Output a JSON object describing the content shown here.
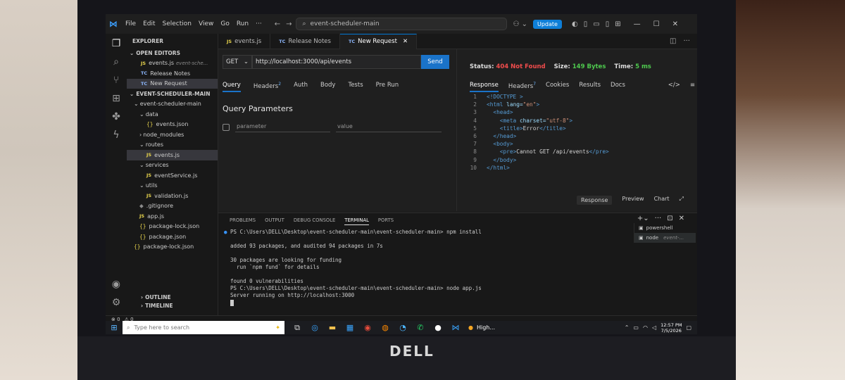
{
  "titlebar": {
    "menu": [
      "File",
      "Edit",
      "Selection",
      "View",
      "Go",
      "Run",
      "···"
    ],
    "search": "event-scheduler-main",
    "update_label": "Update"
  },
  "explorer": {
    "title": "EXPLORER",
    "open_editors_label": "OPEN EDITORS",
    "open_editors": [
      {
        "icon": "JS",
        "name": "events.js",
        "hint": "event-sche..."
      },
      {
        "icon": "TC",
        "name": "Release Notes",
        "hint": ""
      },
      {
        "icon": "TC",
        "name": "New Request",
        "hint": ""
      }
    ],
    "workspace_label": "EVENT-SCHEDULER-MAIN",
    "tree": [
      {
        "indent": 10,
        "type": "folder",
        "name": "event-scheduler-main"
      },
      {
        "indent": 18,
        "type": "folder",
        "name": "data"
      },
      {
        "indent": 28,
        "type": "json",
        "name": "events.json"
      },
      {
        "indent": 18,
        "type": "folder-closed",
        "name": "node_modules"
      },
      {
        "indent": 18,
        "type": "folder",
        "name": "routes"
      },
      {
        "indent": 28,
        "type": "js",
        "name": "events.js"
      },
      {
        "indent": 18,
        "type": "folder",
        "name": "services"
      },
      {
        "indent": 28,
        "type": "js",
        "name": "eventService.js"
      },
      {
        "indent": 18,
        "type": "folder",
        "name": "utils"
      },
      {
        "indent": 28,
        "type": "js",
        "name": "validation.js"
      },
      {
        "indent": 18,
        "type": "git",
        "name": ".gitignore"
      },
      {
        "indent": 18,
        "type": "js",
        "name": "app.js"
      },
      {
        "indent": 18,
        "type": "json",
        "name": "package-lock.json"
      },
      {
        "indent": 18,
        "type": "json",
        "name": "package.json"
      },
      {
        "indent": 10,
        "type": "json",
        "name": "package-lock.json"
      }
    ],
    "outline_label": "OUTLINE",
    "timeline_label": "TIMELINE"
  },
  "tabs": [
    {
      "icon": "JS",
      "label": "events.js"
    },
    {
      "icon": "TC",
      "label": "Release Notes"
    },
    {
      "icon": "TC",
      "label": "New Request",
      "close": "✕"
    }
  ],
  "request": {
    "method": "GET",
    "url": "http://localhost:3000/api/events",
    "send_label": "Send",
    "tabs": [
      "Query",
      "Headers",
      "Auth",
      "Body",
      "Tests",
      "Pre Run"
    ],
    "headers_count": "2",
    "query_title": "Query Parameters",
    "param_placeholder": "parameter",
    "value_placeholder": "value"
  },
  "response": {
    "status_label": "Status:",
    "status_value": "404 Not Found",
    "size_label": "Size:",
    "size_value": "149 Bytes",
    "time_label": "Time:",
    "time_value": "5 ms",
    "tabs": [
      "Response",
      "Headers",
      "Cookies",
      "Results",
      "Docs"
    ],
    "headers_count": "7",
    "bottom_tabs": [
      "Response",
      "Preview",
      "Chart"
    ],
    "lines": [
      {
        "n": "1",
        "html": "<!DOCTYPE html>"
      },
      {
        "n": "2",
        "html": "<html lang=\"en\">"
      },
      {
        "n": "3",
        "html": "  <head>"
      },
      {
        "n": "4",
        "html": "    <meta charset=\"utf-8\">"
      },
      {
        "n": "5",
        "html": "    <title>Error</title>"
      },
      {
        "n": "6",
        "html": "  </head>"
      },
      {
        "n": "7",
        "html": "  <body>"
      },
      {
        "n": "8",
        "html": "    <pre>Cannot GET /api/events</pre>"
      },
      {
        "n": "9",
        "html": "  </body>"
      },
      {
        "n": "10",
        "html": "</html>"
      }
    ]
  },
  "panel": {
    "tabs": [
      "PROBLEMS",
      "OUTPUT",
      "DEBUG CONSOLE",
      "TERMINAL",
      "PORTS"
    ],
    "terminal_lines": [
      "PS C:\\Users\\DELL\\Desktop\\event-scheduler-main\\event-scheduler-main> npm install",
      "",
      "added 93 packages, and audited 94 packages in 7s",
      "",
      "30 packages are looking for funding",
      "  run `npm fund` for details",
      "",
      "found 0 vulnerabilities",
      "PS C:\\Users\\DELL\\Desktop\\event-scheduler-main\\event-scheduler-main> node app.js",
      "Server running on http://localhost:3000"
    ],
    "shells": [
      {
        "label": "powershell"
      },
      {
        "label": "node",
        "hint": "event-..."
      }
    ]
  },
  "statusbar": {
    "errors": "0",
    "warnings": "0"
  },
  "taskbar": {
    "search_placeholder": "Type here to search",
    "app_label": "High...",
    "time": "12:57 PM",
    "date": "7/5/2026"
  },
  "brand": "DELL"
}
